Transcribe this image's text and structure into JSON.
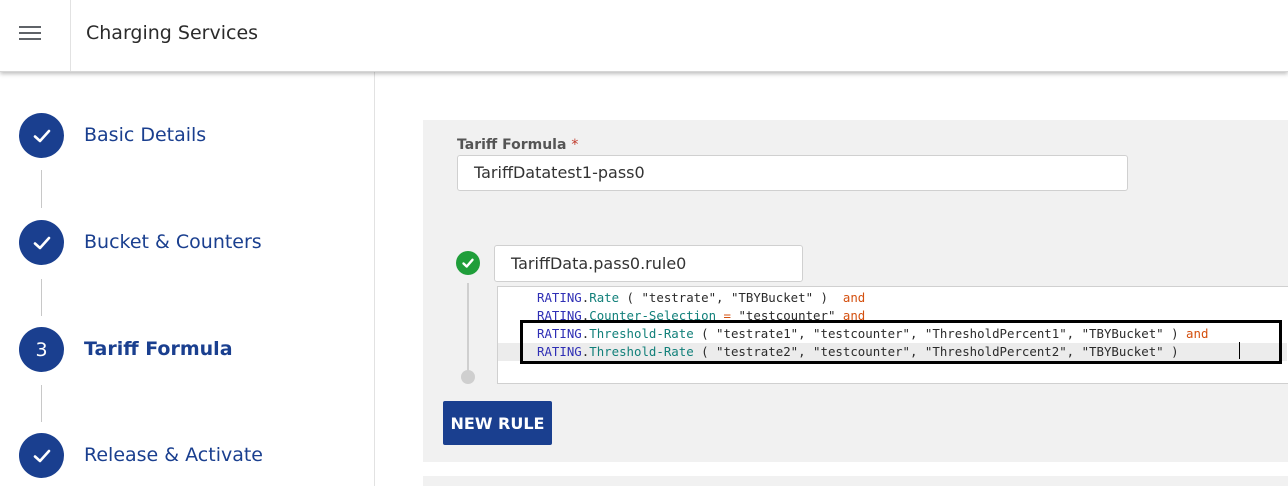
{
  "header": {
    "title": "Charging Services",
    "menu_icon": "hamburger-menu-icon"
  },
  "stepper": {
    "steps": [
      {
        "label": "Basic Details",
        "state": "done",
        "icon": "check-icon"
      },
      {
        "label": "Bucket & Counters",
        "state": "done",
        "icon": "check-icon"
      },
      {
        "label": "Tariff Formula",
        "state": "active",
        "number": "3"
      },
      {
        "label": "Release & Activate",
        "state": "done",
        "icon": "check-icon"
      }
    ]
  },
  "form": {
    "tariff_formula_label": "Tariff Formula",
    "required_marker": "*",
    "tariff_formula_value": "TariffDatatest1-pass0",
    "rule_name_value": "TariffData.pass0.rule0",
    "rule_status_icon": "check-circle-icon",
    "new_rule_label": "NEW RULE"
  },
  "editor": {
    "lines": [
      {
        "obj": "RATING",
        "dot": ".",
        "fn": "Rate",
        "args": " ( \"testrate\", \"TBYBucket\" )  ",
        "tail": "and"
      },
      {
        "obj": "RATING",
        "dot": ".",
        "fn": "Counter-Selection",
        "eq": " = ",
        "args": "\"testcounter\" ",
        "tail": "and"
      },
      {
        "obj": "RATING",
        "dot": ".",
        "fn": "Threshold-Rate",
        "args": " ( \"testrate1\", \"testcounter\", \"ThresholdPercent1\", \"TBYBucket\" ) ",
        "tail": "and"
      },
      {
        "obj": "RATING",
        "dot": ".",
        "fn": "Threshold-Rate",
        "args": " ( \"testrate2\", \"testcounter\", \"ThresholdPercent2\", \"TBYBucket\" )",
        "tail": ""
      }
    ]
  },
  "colors": {
    "primary": "#1a3f8f",
    "success": "#1f9e3a",
    "panel_bg": "#f1f1f1",
    "keyword": "#2f2fb5",
    "function": "#12807a",
    "operator": "#d4500f"
  }
}
